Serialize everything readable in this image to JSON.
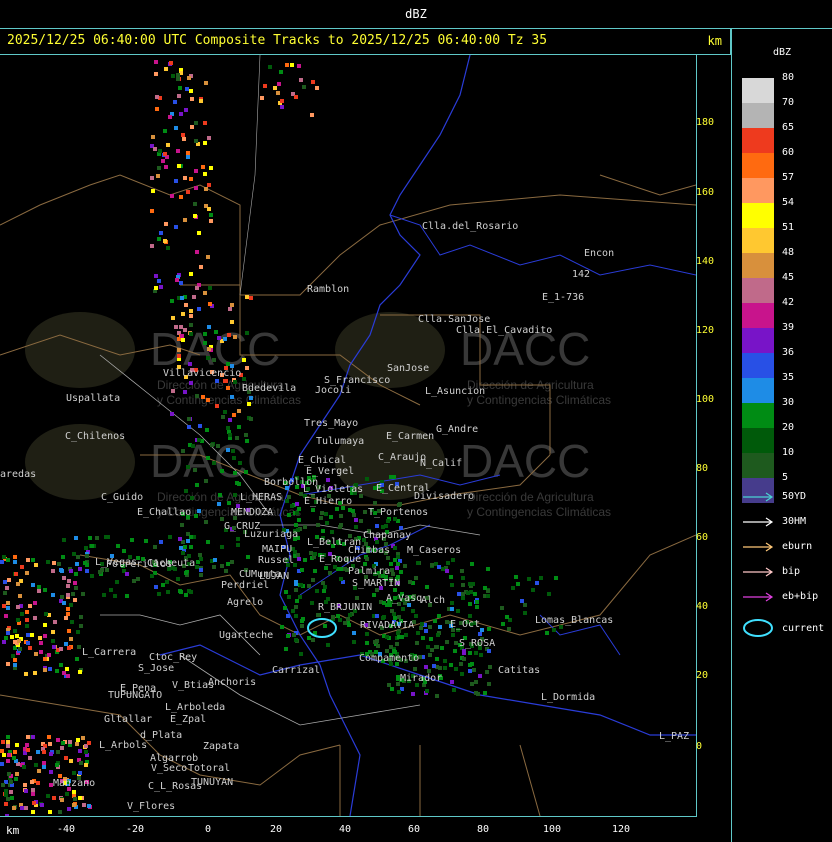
{
  "header": {
    "units_label": "dBZ",
    "title": "2025/12/25 06:40:00 UTC Composite Tracks to 2025/12/25 06:40:00 Tz 35",
    "km_label": "km"
  },
  "x_axis": {
    "km_label": "km",
    "ticks": [
      "-40",
      "-20",
      "0",
      "20",
      "40",
      "60",
      "80",
      "100",
      "120"
    ]
  },
  "y_axis": {
    "ticks": [
      "180",
      "160",
      "140",
      "120",
      "100",
      "80",
      "60",
      "40",
      "20",
      "0"
    ]
  },
  "legend": {
    "title": "dBZ",
    "levels": [
      {
        "label": "80",
        "color": "#d8d8d8"
      },
      {
        "label": "70",
        "color": "#b4b4b4"
      },
      {
        "label": "65",
        "color": "#ee3a1e"
      },
      {
        "label": "60",
        "color": "#ff6a10"
      },
      {
        "label": "57",
        "color": "#ff9860"
      },
      {
        "label": "54",
        "color": "#ffff00"
      },
      {
        "label": "51",
        "color": "#ffc830"
      },
      {
        "label": "48",
        "color": "#d8903c"
      },
      {
        "label": "45",
        "color": "#c06a8a"
      },
      {
        "label": "42",
        "color": "#c8148c"
      },
      {
        "label": "39",
        "color": "#7814c8"
      },
      {
        "label": "36",
        "color": "#2850e6"
      },
      {
        "label": "35",
        "color": "#1e8ce6"
      },
      {
        "label": "30",
        "color": "#008c14"
      },
      {
        "label": "20",
        "color": "#005a0a"
      },
      {
        "label": "10",
        "color": "#1e5a1e"
      },
      {
        "label": "5",
        "color": "#463c8c"
      }
    ],
    "tracks": [
      {
        "label": "50YD",
        "color": "#4ad2d2"
      },
      {
        "label": "30HM",
        "color": "#ffffff"
      },
      {
        "label": "eburn",
        "color": "#ffc878"
      },
      {
        "label": "bip",
        "color": "#ffc8c8"
      },
      {
        "label": "eb+bip",
        "color": "#e040e0"
      }
    ],
    "current_label": "current",
    "current_color": "#40e0ff"
  },
  "watermark": {
    "brand": "DACC",
    "line1": "Dirección de Agricultura",
    "line2": "y Contingencias Climáticas"
  },
  "cities": [
    {
      "name": "Clla.del_Rosario"
    },
    {
      "name": "Encon"
    },
    {
      "name": "142"
    },
    {
      "name": "E_1-736"
    },
    {
      "name": "Ramblon"
    },
    {
      "name": "Clla.SanJose"
    },
    {
      "name": "Clla.El_Cavadito"
    },
    {
      "name": "Villavicencio"
    },
    {
      "name": "Uspallata"
    },
    {
      "name": "Bdedevila"
    },
    {
      "name": "S_Francisco"
    },
    {
      "name": "Jocoli"
    },
    {
      "name": "SanJose"
    },
    {
      "name": "L_Asuncion"
    },
    {
      "name": "Tres_Mayo"
    },
    {
      "name": "Tulumaya"
    },
    {
      "name": "E_Carmen"
    },
    {
      "name": "G_Andre"
    },
    {
      "name": "C_Chilenos"
    },
    {
      "name": "E_Chical"
    },
    {
      "name": "E_Vergel"
    },
    {
      "name": "C_Araujo"
    },
    {
      "name": "N_Calif"
    },
    {
      "name": "aredas"
    },
    {
      "name": "Borbollon"
    },
    {
      "name": "E_Central"
    },
    {
      "name": "Divisadero"
    },
    {
      "name": "C_Guido"
    },
    {
      "name": "L_HERAS"
    },
    {
      "name": "L_Violetas"
    },
    {
      "name": "E_Hierro"
    },
    {
      "name": "E_Challao"
    },
    {
      "name": "MENDOZA"
    },
    {
      "name": "G_CRUZ"
    },
    {
      "name": "T_Portenos"
    },
    {
      "name": "Chapanay"
    },
    {
      "name": "Luzuriaga"
    },
    {
      "name": "L_Beltran"
    },
    {
      "name": "MAIPU"
    },
    {
      "name": "Chimbas"
    },
    {
      "name": "M_Caseros"
    },
    {
      "name": "Potrerillos"
    },
    {
      "name": "Russel"
    },
    {
      "name": "L_Vegas"
    },
    {
      "name": "Cacheuta"
    },
    {
      "name": "LUJAN"
    },
    {
      "name": "CUMunta"
    },
    {
      "name": "E_Roque"
    },
    {
      "name": "Palmira"
    },
    {
      "name": "Perdriel"
    },
    {
      "name": "S_MARTIN"
    },
    {
      "name": "Agrelo"
    },
    {
      "name": "A_Vasq"
    },
    {
      "name": "Alch"
    },
    {
      "name": "R_BRJUNIN"
    },
    {
      "name": "Lomas_Blancas"
    },
    {
      "name": "Ugarteche"
    },
    {
      "name": "RIVADAVIA"
    },
    {
      "name": "E_Oct"
    },
    {
      "name": "L_Carrera"
    },
    {
      "name": "Ctoc_Rey"
    },
    {
      "name": "S_Jose"
    },
    {
      "name": "Carrizal"
    },
    {
      "name": "Compamento"
    },
    {
      "name": "S_ROSA"
    },
    {
      "name": "Catitas"
    },
    {
      "name": "Anchoris"
    },
    {
      "name": "Mirador"
    },
    {
      "name": "E_Pena"
    },
    {
      "name": "V_Btias"
    },
    {
      "name": "TUPUNGATO"
    },
    {
      "name": "L_Dormida"
    },
    {
      "name": "L_Arboleda"
    },
    {
      "name": "Gltallar"
    },
    {
      "name": "E_Zpal"
    },
    {
      "name": "d_Plata"
    },
    {
      "name": "L_Arbols"
    },
    {
      "name": "Zapata"
    },
    {
      "name": "Algarrob"
    },
    {
      "name": "V_Seco"
    },
    {
      "name": "Totoral"
    },
    {
      "name": "TUNUYAN"
    },
    {
      "name": "Manzano"
    },
    {
      "name": "C_L_Rosas"
    },
    {
      "name": "V_Flores"
    },
    {
      "name": "L_PAZ"
    }
  ]
}
